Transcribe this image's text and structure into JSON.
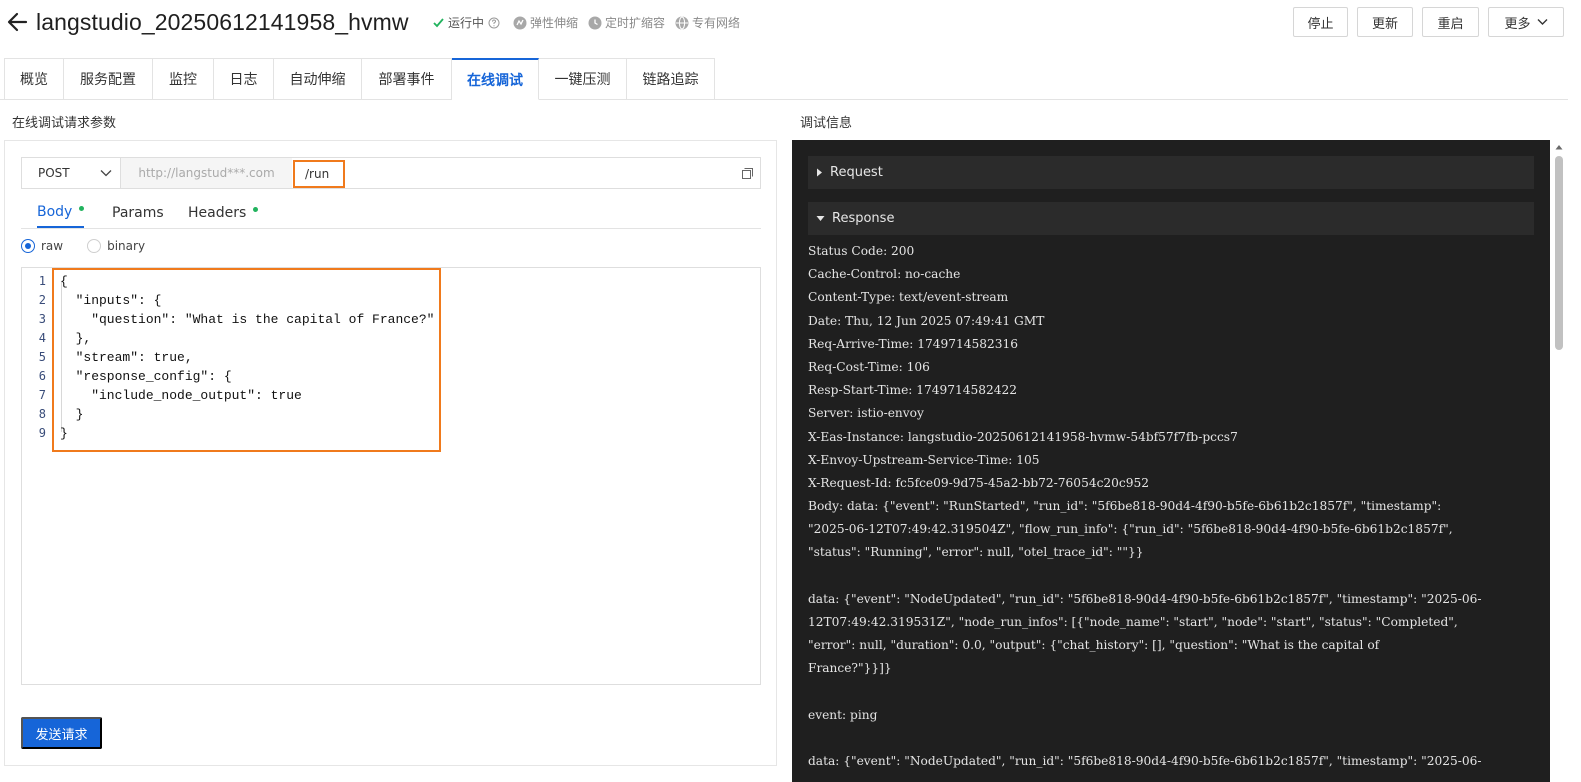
{
  "header": {
    "title": "langstudio_20250612141958_hvmw",
    "status_running": "运行中",
    "elastic_scaling": "弹性伸缩",
    "scheduled_scaling": "定时扩缩容",
    "private_network": "专有网络",
    "buttons": {
      "stop": "停止",
      "update": "更新",
      "restart": "重启",
      "more": "更多"
    }
  },
  "tabs": [
    "概览",
    "服务配置",
    "监控",
    "日志",
    "自动伸缩",
    "部署事件",
    "在线调试",
    "一键压测",
    "链路追踪"
  ],
  "active_tab": "在线调试",
  "left": {
    "section_title": "在线调试请求参数",
    "method": "POST",
    "base_url": "http://langstud***.com",
    "path": "/run",
    "body_tabs": {
      "body": "Body",
      "params": "Params",
      "headers": "Headers"
    },
    "radio": {
      "raw": "raw",
      "binary": "binary",
      "selected": "raw"
    },
    "code_lines": [
      "{",
      "  \"inputs\": {",
      "    \"question\": \"What is the capital of France?\"",
      "  },",
      "  \"stream\": true,",
      "  \"response_config\": {",
      "    \"include_node_output\": true",
      "  }",
      "}"
    ],
    "line_numbers": [
      "1",
      "2",
      "3",
      "4",
      "5",
      "6",
      "7",
      "8",
      "9"
    ],
    "send_button": "发送请求"
  },
  "right": {
    "section_title": "调试信息",
    "request_label": "Request",
    "response_label": "Response",
    "response_lines": [
      "Status Code: 200",
      "Cache-Control: no-cache",
      "Content-Type: text/event-stream",
      "Date: Thu, 12 Jun 2025 07:49:41 GMT",
      "Req-Arrive-Time: 1749714582316",
      "Req-Cost-Time: 106",
      "Resp-Start-Time: 1749714582422",
      "Server: istio-envoy",
      "X-Eas-Instance: langstudio-20250612141958-hvmw-54bf57f7fb-pccs7",
      "X-Envoy-Upstream-Service-Time: 105",
      "X-Request-Id: fc5fce09-9d75-45a2-bb72-76054c20c952",
      "Body: data: {\"event\": \"RunStarted\", \"run_id\": \"5f6be818-90d4-4f90-b5fe-6b61b2c1857f\", \"timestamp\":",
      "\"2025-06-12T07:49:42.319504Z\", \"flow_run_info\": {\"run_id\": \"5f6be818-90d4-4f90-b5fe-6b61b2c1857f\",",
      "\"status\": \"Running\", \"error\": null, \"otel_trace_id\": \"\"}}",
      "",
      "data: {\"event\": \"NodeUpdated\", \"run_id\": \"5f6be818-90d4-4f90-b5fe-6b61b2c1857f\", \"timestamp\": \"2025-06-",
      "12T07:49:42.319531Z\", \"node_run_infos\": [{\"node_name\": \"start\", \"node\": \"start\", \"status\": \"Completed\",",
      "\"error\": null, \"duration\": 0.0, \"output\": {\"chat_history\": [], \"question\": \"What is the capital of",
      "France?\"}}]}",
      "",
      "event: ping",
      "",
      "data: {\"event\": \"NodeUpdated\", \"run_id\": \"5f6be818-90d4-4f90-b5fe-6b61b2c1857f\", \"timestamp\": \"2025-06-"
    ]
  },
  "colors": {
    "accent": "#1665d8",
    "highlight_orange": "#f07a1c",
    "status_green": "#22b35e",
    "debug_bg": "#1f1f1f"
  },
  "icons": [
    "back-arrow-icon",
    "check-icon",
    "help-icon",
    "elastic-icon",
    "clock-icon",
    "globe-icon",
    "chevron-down-icon",
    "expand-icon",
    "caret-right-icon",
    "caret-down-icon"
  ]
}
